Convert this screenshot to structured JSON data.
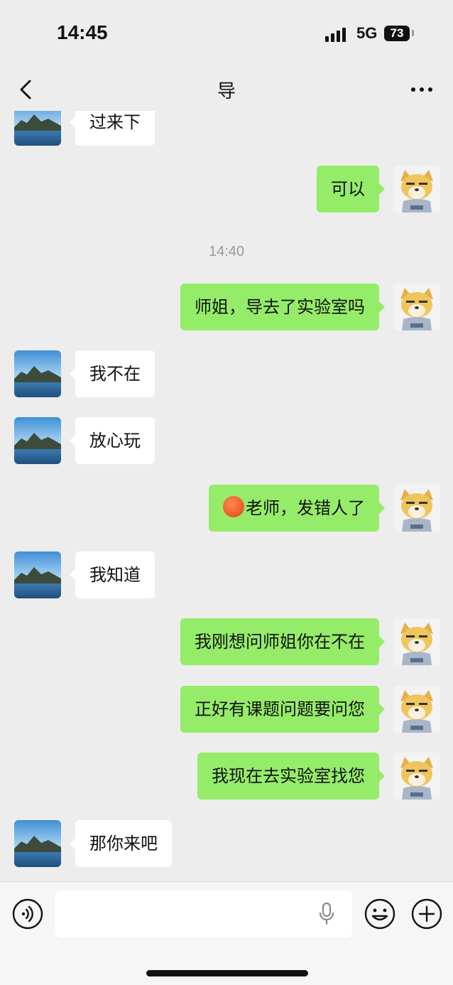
{
  "status_bar": {
    "time": "14:45",
    "network": "5G",
    "battery": "73"
  },
  "nav": {
    "title": "导"
  },
  "messages": [
    {
      "side": "left",
      "text": "过来下"
    },
    {
      "side": "right",
      "text": "可以"
    },
    {
      "side": "right",
      "text": "师姐，导去了实验室吗"
    },
    {
      "side": "left",
      "text": "我不在"
    },
    {
      "side": "left",
      "text": "放心玩"
    },
    {
      "side": "right",
      "text": "老师，发错人了",
      "emoji": "sweat-face"
    },
    {
      "side": "left",
      "text": "我知道"
    },
    {
      "side": "right",
      "text": "我刚想问师姐你在不在"
    },
    {
      "side": "right",
      "text": "正好有课题问题要问您"
    },
    {
      "side": "right",
      "text": "我现在去实验室找您"
    },
    {
      "side": "left",
      "text": "那你来吧"
    }
  ],
  "timestamp": "14:40",
  "input": {
    "value": "",
    "placeholder": ""
  },
  "icons": {
    "back": "chevron-left-icon",
    "more": "more-icon",
    "voice": "voice-icon",
    "mic": "mic-icon",
    "emoji": "emoji-icon",
    "plus": "plus-icon"
  },
  "colors": {
    "background": "#ededed",
    "my_bubble": "#95ec69",
    "their_bubble": "#ffffff"
  }
}
